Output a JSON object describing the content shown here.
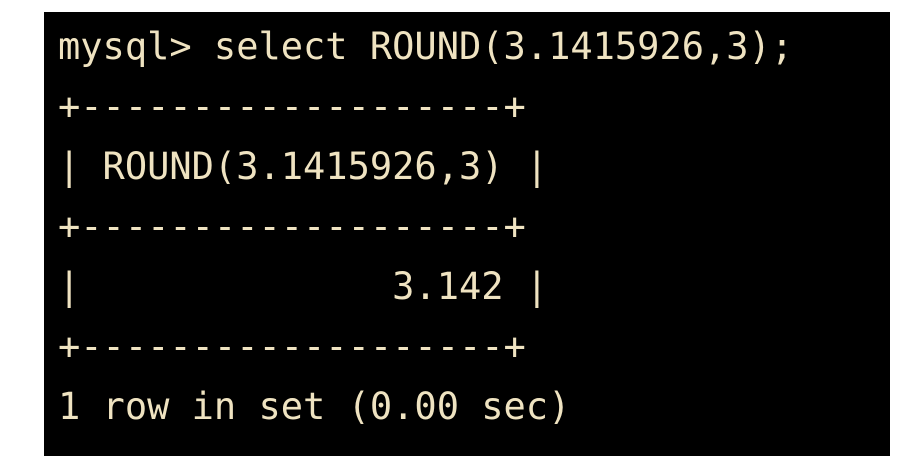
{
  "terminal": {
    "text_color": "#efe3c1",
    "background": "#000000",
    "lines": [
      "mysql> select ROUND(3.1415926,3);",
      "+-------------------+",
      "| ROUND(3.1415926,3) |",
      "+-------------------+",
      "|              3.142 |",
      "+-------------------+",
      "1 row in set (0.00 sec)"
    ]
  }
}
